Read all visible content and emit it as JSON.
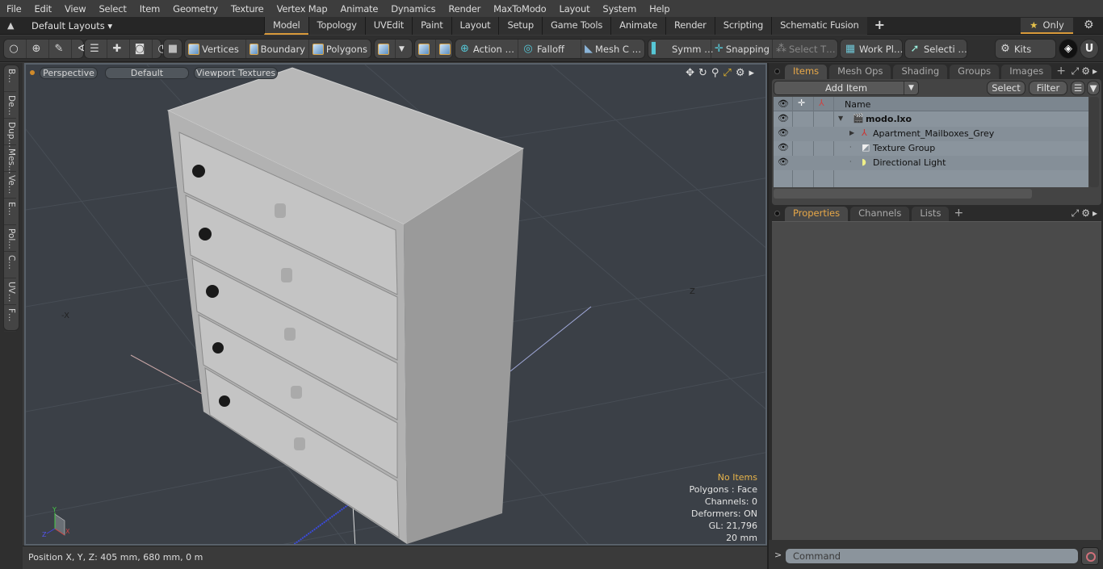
{
  "menu": [
    "File",
    "Edit",
    "View",
    "Select",
    "Item",
    "Geometry",
    "Texture",
    "Vertex Map",
    "Animate",
    "Dynamics",
    "Render",
    "MaxToModo",
    "Layout",
    "System",
    "Help"
  ],
  "layouts": {
    "label": "Default Layouts ▾"
  },
  "tabs": [
    {
      "label": "Model",
      "active": true
    },
    {
      "label": "Topology"
    },
    {
      "label": "UVEdit"
    },
    {
      "label": "Paint"
    },
    {
      "label": "Layout"
    },
    {
      "label": "Setup"
    },
    {
      "label": "Game Tools"
    },
    {
      "label": "Animate"
    },
    {
      "label": "Render"
    },
    {
      "label": "Scripting"
    },
    {
      "label": "Schematic Fusion"
    }
  ],
  "only": {
    "label": "Only"
  },
  "toolbar": {
    "vertices": "Vertices",
    "boundary": "Boundary",
    "polygons": "Polygons",
    "action": "Action …",
    "falloff": "Falloff",
    "meshc": "Mesh C …",
    "symm": "Symm …",
    "snapping": "Snapping",
    "selectt": "Select T…",
    "workpl": "Work Pl…",
    "selecti": "Selecti …",
    "kits": "Kits"
  },
  "left_tabs": [
    "B…",
    "De…",
    "Dup…",
    "Mes…",
    "Ve…",
    "E…",
    "Pol…",
    "C…",
    "UV…",
    "F…"
  ],
  "viewport": {
    "view": "Perspective",
    "style": "Default",
    "textures": "Viewport Textures",
    "stats": {
      "selection": "No Items",
      "polygons": "Polygons : Face",
      "channels": "Channels: 0",
      "deformers": "Deformers: ON",
      "gl": "GL: 21,796",
      "grid": "20 mm"
    },
    "axis": {
      "x": "X",
      "y": "Y",
      "z": "Z",
      "neg_x": "-X",
      "z_far": "Z"
    }
  },
  "status": {
    "position": "Position X, Y, Z:   405 mm, 680 mm, 0 m"
  },
  "items_panel": {
    "tabs": [
      {
        "label": "Items",
        "active": true
      },
      {
        "label": "Mesh Ops"
      },
      {
        "label": "Shading"
      },
      {
        "label": "Groups"
      },
      {
        "label": "Images"
      }
    ],
    "add_item": "Add Item",
    "select": "Select",
    "filter": "Filter",
    "name_col": "Name",
    "tree": [
      {
        "label": "modo.lxo",
        "icon": "scene-icon",
        "bold": true
      },
      {
        "label": "Apartment_Mailboxes_Grey",
        "icon": "mesh-icon"
      },
      {
        "label": "Texture Group",
        "icon": "texture-group-icon"
      },
      {
        "label": "Directional Light",
        "icon": "light-icon"
      }
    ]
  },
  "props_panel": {
    "tabs": [
      {
        "label": "Properties",
        "active": true
      },
      {
        "label": "Channels"
      },
      {
        "label": "Lists"
      }
    ]
  },
  "command": {
    "placeholder": "Command",
    "prompt": ">"
  }
}
